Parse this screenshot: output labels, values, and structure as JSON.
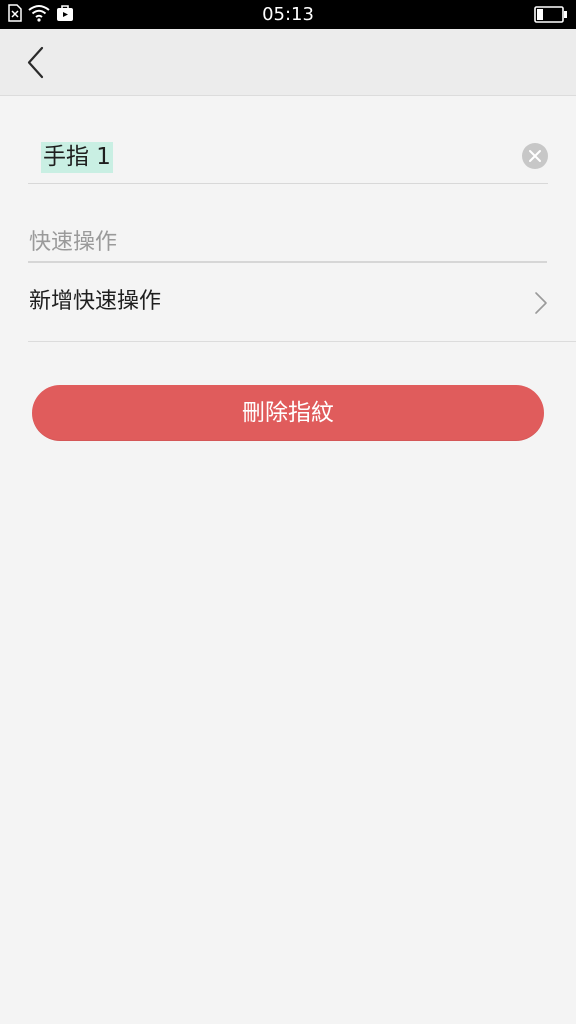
{
  "status_bar": {
    "time": "05:13",
    "icons": [
      "no-sim-icon",
      "wifi-icon",
      "app-notification-icon",
      "battery-icon"
    ]
  },
  "header": {
    "back_icon": "chevron-left-icon"
  },
  "fingerprint_name": {
    "value": "手指 1",
    "clear_icon": "clear-circle-icon"
  },
  "quick_actions": {
    "section_title": "快速操作",
    "add_label": "新增快速操作",
    "chevron_icon": "chevron-right-icon"
  },
  "delete_button": {
    "label": "刪除指紋",
    "color": "#e05c5c"
  }
}
